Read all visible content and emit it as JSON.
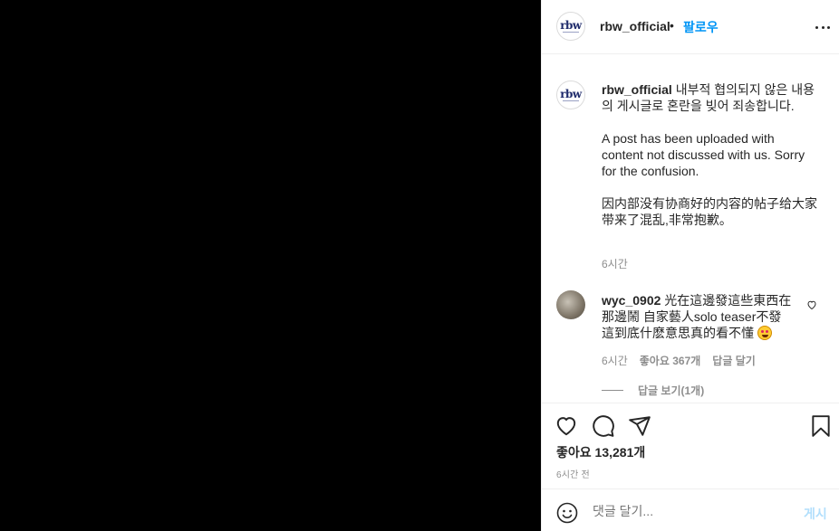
{
  "header": {
    "logo_text": "rbw",
    "username": "rbw_official",
    "dot": "•",
    "follow_label": "팔로우",
    "more_icon": "more-horizontal-icon"
  },
  "caption": {
    "logo_text": "rbw",
    "username": "rbw_official",
    "text_ko": "내부적 협의되지 않은 내용의 게시글로 혼란을 빚어 죄송합니다.",
    "text_en": "A post has been uploaded with content not discussed with us. Sorry for the confusion.",
    "text_zh": "因内部没有协商好的内容的帖子给大家带来了混乱,非常抱歉。",
    "time": "6시간"
  },
  "comment": {
    "username": "wyc_0902",
    "text": "光在這邊發這些東西在那邊鬧 自家藝人solo teaser不發 這到底什麽意思真的看不懂",
    "emoji": "star-struck-emoji",
    "time": "6시간",
    "likes": "좋아요 367개",
    "reply_label": "답글 달기",
    "view_replies": "답글 보기(1개)",
    "heart_icon": "heart-outline-icon"
  },
  "actions": {
    "icons": [
      "heart-icon",
      "comment-icon",
      "share-icon",
      "bookmark-icon"
    ],
    "likes_text": "좋아요 13,281개",
    "time_ago": "6시간 전"
  },
  "comment_box": {
    "smile_icon": "smile-icon",
    "placeholder": "댓글 달기...",
    "post_label": "게시",
    "post_color": "#b2dffc"
  },
  "colors": {
    "accent": "#0095f6",
    "text": "#262626",
    "muted": "#8e8e8e",
    "media_bg": "#000000"
  }
}
